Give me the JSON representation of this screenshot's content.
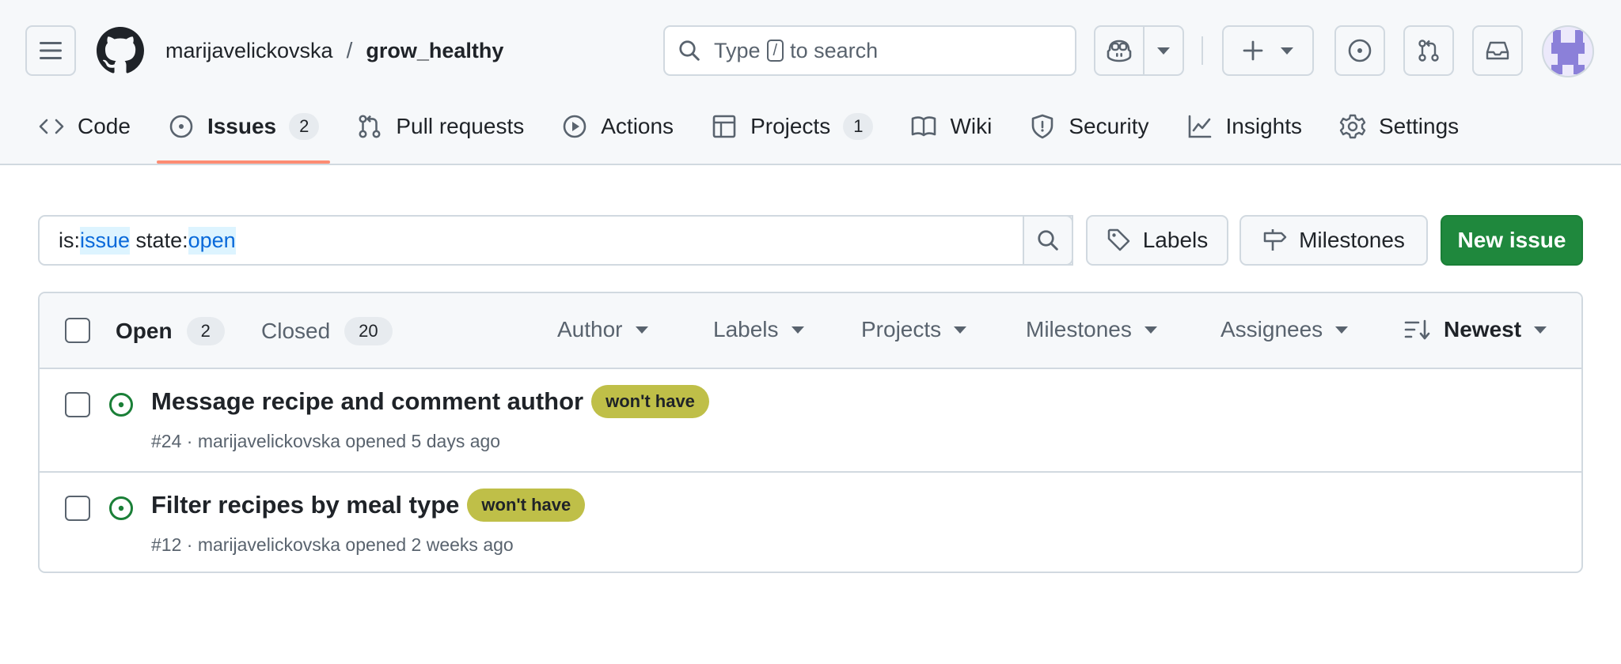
{
  "repo": {
    "owner": "marijavelickovska",
    "separator": "/",
    "name": "grow_healthy"
  },
  "search": {
    "prefix": "Type",
    "key": "/",
    "suffix": "to search"
  },
  "nav": {
    "code": "Code",
    "issues": "Issues",
    "issues_count": "2",
    "pull_requests": "Pull requests",
    "actions": "Actions",
    "projects": "Projects",
    "projects_count": "1",
    "wiki": "Wiki",
    "security": "Security",
    "insights": "Insights",
    "settings": "Settings"
  },
  "filter": {
    "t1_key": "is:",
    "t1_val": "issue",
    "t2_key": "state:",
    "t2_val": "open"
  },
  "toolbar": {
    "labels": "Labels",
    "milestones": "Milestones",
    "new_issue": "New issue"
  },
  "list_header": {
    "open_label": "Open",
    "open_count": "2",
    "closed_label": "Closed",
    "closed_count": "20",
    "author": "Author",
    "labels": "Labels",
    "projects": "Projects",
    "milestones": "Milestones",
    "assignees": "Assignees",
    "sort": "Newest"
  },
  "issues": [
    {
      "title": "Message recipe and comment author",
      "label": "won't have",
      "meta": "#24 · marijavelickovska opened 5 days ago"
    },
    {
      "title": "Filter recipes by meal type",
      "label": "won't have",
      "meta": "#12 · marijavelickovska opened 2 weeks ago"
    }
  ],
  "colors": {
    "accent_underline": "#fd8c73",
    "primary_button": "#1f883d",
    "open_icon": "#1a7f37",
    "label_wont_have": "#bfbf48"
  }
}
